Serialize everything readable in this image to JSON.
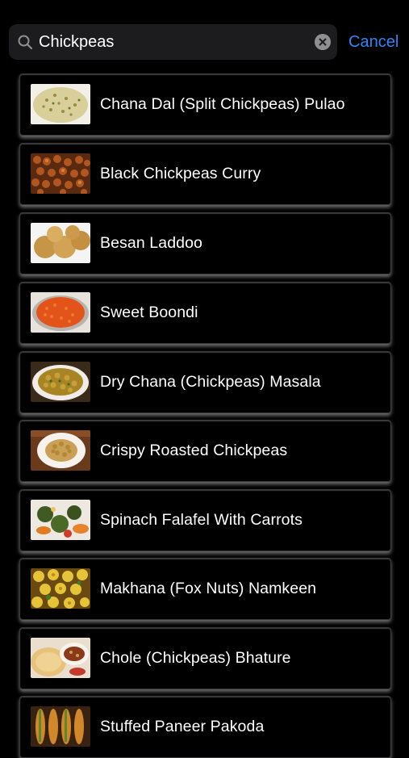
{
  "search": {
    "value": "Chickpeas",
    "cancel_label": "Cancel"
  },
  "icons": {
    "search": "magnifying-glass",
    "clear": "circle-x"
  },
  "colors": {
    "background": "#000000",
    "search_field": "#1c1c1e",
    "accent": "#2f86f7"
  },
  "recipes": [
    {
      "title": "Chana Dal (Split Chickpeas) Pulao"
    },
    {
      "title": "Black Chickpeas Curry"
    },
    {
      "title": "Besan Laddoo"
    },
    {
      "title": "Sweet Boondi"
    },
    {
      "title": "Dry Chana (Chickpeas) Masala"
    },
    {
      "title": "Crispy Roasted Chickpeas"
    },
    {
      "title": "Spinach Falafel With Carrots"
    },
    {
      "title": "Makhana (Fox Nuts) Namkeen"
    },
    {
      "title": "Chole (Chickpeas) Bhature"
    },
    {
      "title": "Stuffed Paneer Pakoda"
    }
  ]
}
